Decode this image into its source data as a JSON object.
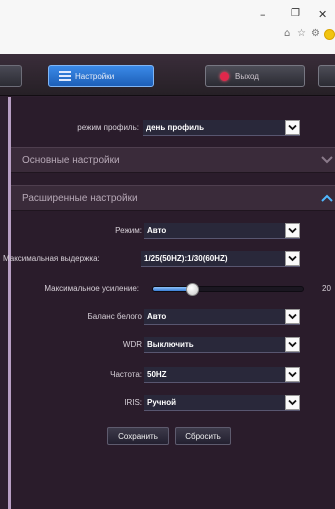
{
  "window_controls": {
    "minimize": "–",
    "maximize": "❐",
    "close": "✕"
  },
  "extensions": [
    "⌂",
    "☆",
    "⚙"
  ],
  "tabs": {
    "settings": "Настройки",
    "exit": "Выход"
  },
  "profile": {
    "label": "режим профиль:",
    "value": "день профиль"
  },
  "sections": {
    "basic": "Основные настройки",
    "advanced": "Расширенные настройки"
  },
  "settings": {
    "mode": {
      "label": "Режим:",
      "value": "Авто"
    },
    "max_exposure": {
      "label": "Максимальная выдержка:",
      "value": "1/25(50HZ):1/30(60HZ)"
    },
    "max_gain": {
      "label": "Максимальное усиление:",
      "value": "20",
      "fraction": 0.26
    },
    "white_balance": {
      "label": "Баланс белого",
      "value": "Авто"
    },
    "wdr": {
      "label": "WDR",
      "value": "Выключить"
    },
    "frequency": {
      "label": "Частота:",
      "value": "50HZ"
    },
    "iris": {
      "label": "IRIS:",
      "value": "Ручной"
    }
  },
  "buttons": {
    "save": "Сохранить",
    "reset": "Сбросить"
  },
  "colors": {
    "accent": "#2f7de1",
    "exit_red": "#e0284b",
    "panel_bg": "#2a1c2b"
  }
}
